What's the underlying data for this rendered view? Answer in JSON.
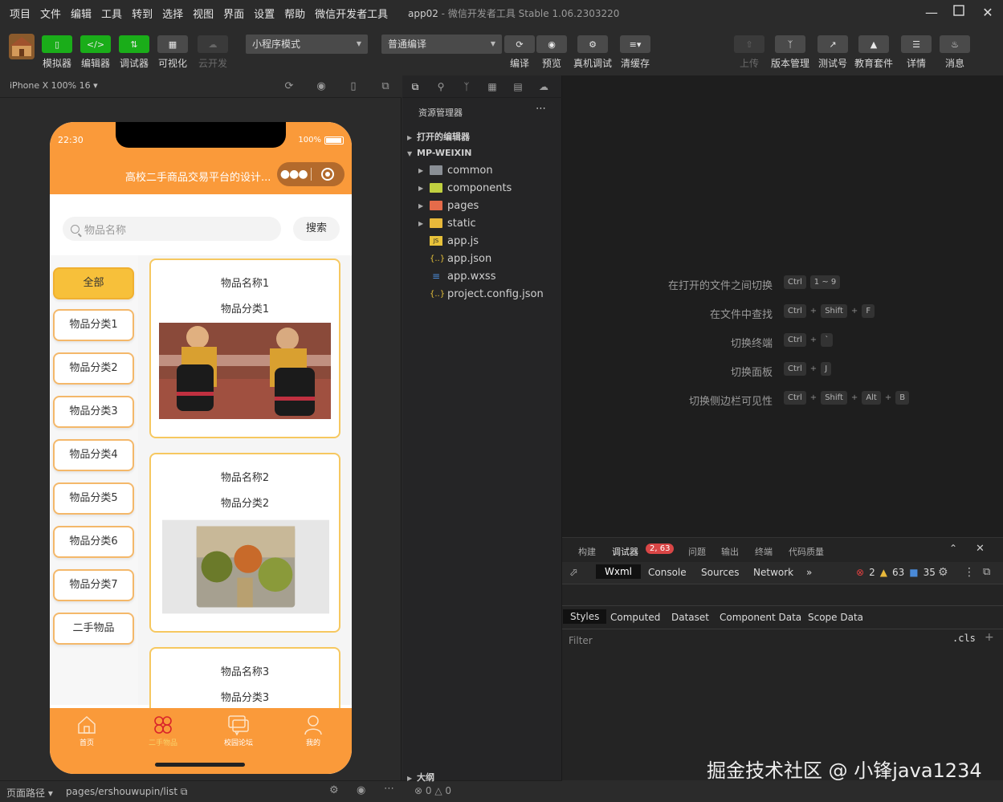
{
  "menubar": {
    "items": [
      "项目",
      "文件",
      "编辑",
      "工具",
      "转到",
      "选择",
      "视图",
      "界面",
      "设置",
      "帮助",
      "微信开发者工具"
    ],
    "project": "app02",
    "app_title": "微信开发者工具 Stable 1.06.2303220"
  },
  "toolbar": {
    "simulator": "模拟器",
    "editor": "编辑器",
    "debugger": "调试器",
    "visual": "可视化",
    "cloud": "云开发",
    "mode": "小程序模式",
    "compile_mode": "普通编译",
    "compile": "编译",
    "preview": "预览",
    "real_debug": "真机调试",
    "clear_cache": "清缓存",
    "upload": "上传",
    "version": "版本管理",
    "test_account": "测试号",
    "edu": "教育套件",
    "details": "详情",
    "messages": "消息"
  },
  "simulator": {
    "device": "iPhone X 100% 16",
    "phone": {
      "time": "22:30",
      "battery": "100%",
      "nav_title": "高校二手商品交易平台的设计...",
      "search_placeholder": "物品名称",
      "search_button": "搜索",
      "categories": [
        "全部",
        "物品分类1",
        "物品分类2",
        "物品分类3",
        "物品分类4",
        "物品分类5",
        "物品分类6",
        "物品分类7",
        "二手物品"
      ],
      "cards": [
        {
          "name": "物品名称1",
          "category": "物品分类1"
        },
        {
          "name": "物品名称2",
          "category": "物品分类2"
        },
        {
          "name": "物品名称3",
          "category": "物品分类3"
        }
      ],
      "tabs": [
        "首页",
        "二手物品",
        "校园论坛",
        "我的"
      ]
    }
  },
  "footer": {
    "path_label": "页面路径",
    "route": "pages/ershouwupin/list"
  },
  "explorer": {
    "title": "资源管理器",
    "open_editors": "打开的编辑器",
    "project": "MP-WEIXIN",
    "folders": [
      "common",
      "components",
      "pages",
      "static"
    ],
    "files": [
      "app.js",
      "app.json",
      "app.wxss",
      "project.config.json"
    ],
    "outline": "大纲",
    "errors": "0",
    "warnings": "0"
  },
  "shortcuts": [
    {
      "label": "在打开的文件之间切换",
      "keys": [
        "Ctrl",
        "1 ~ 9"
      ]
    },
    {
      "label": "在文件中查找",
      "keys": [
        "Ctrl",
        "+",
        "Shift",
        "+",
        "F"
      ]
    },
    {
      "label": "切换终端",
      "keys": [
        "Ctrl",
        "+",
        "`"
      ]
    },
    {
      "label": "切换面板",
      "keys": [
        "Ctrl",
        "+",
        "J"
      ]
    },
    {
      "label": "切换侧边栏可见性",
      "keys": [
        "Ctrl",
        "+",
        "Shift",
        "+",
        "Alt",
        "+",
        "B"
      ]
    }
  ],
  "devtools": {
    "tabs": [
      "构建",
      "调试器",
      "问题",
      "输出",
      "终端",
      "代码质量"
    ],
    "debugger_badge": "2, 63",
    "panels": [
      "Wxml",
      "Console",
      "Sources",
      "Network"
    ],
    "errors": "2",
    "warnings": "63",
    "infos": "35",
    "sub_tabs": [
      "Styles",
      "Computed",
      "Dataset",
      "Component Data",
      "Scope Data"
    ],
    "filter": "Filter",
    "cls": ".cls"
  },
  "watermark": "掘金技术社区 @ 小锋java1234",
  "colors": {
    "accent_orange": "#fa9a3a",
    "active_category": "#f7c03a",
    "wechat_green": "#1aad19"
  }
}
